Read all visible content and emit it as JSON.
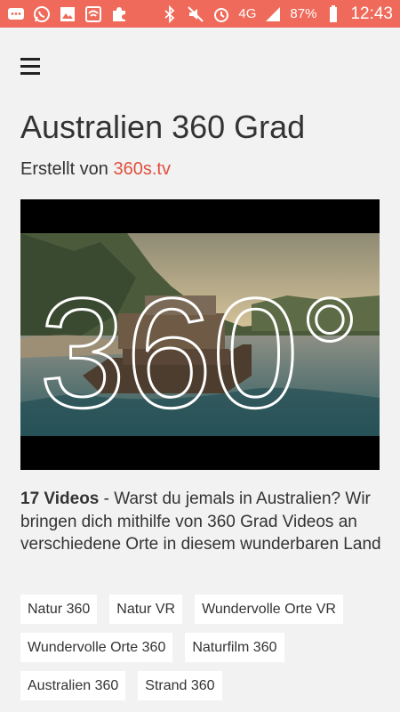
{
  "status_bar": {
    "battery": "87%",
    "network": "4G",
    "time": "12:43"
  },
  "page": {
    "title": "Australien 360 Grad",
    "byline_prefix": "Erstellt von ",
    "byline_link": "360s.tv"
  },
  "video": {
    "overlay_text": "360°"
  },
  "description": {
    "count": "17 Videos",
    "separator": " - ",
    "text": "Warst du jemals in Australien? Wir bringen dich mithilfe von 360 Grad Videos an verschiedene Orte in diesem wunderbaren Land"
  },
  "tags": [
    "Natur 360",
    "Natur VR",
    "Wundervolle Orte VR",
    "Wundervolle Orte 360",
    "Naturfilm 360",
    "Australien 360",
    "Strand 360"
  ],
  "colors": {
    "accent": "#ef6a5a",
    "link": "#e0503e",
    "background": "#f2f2f2"
  }
}
